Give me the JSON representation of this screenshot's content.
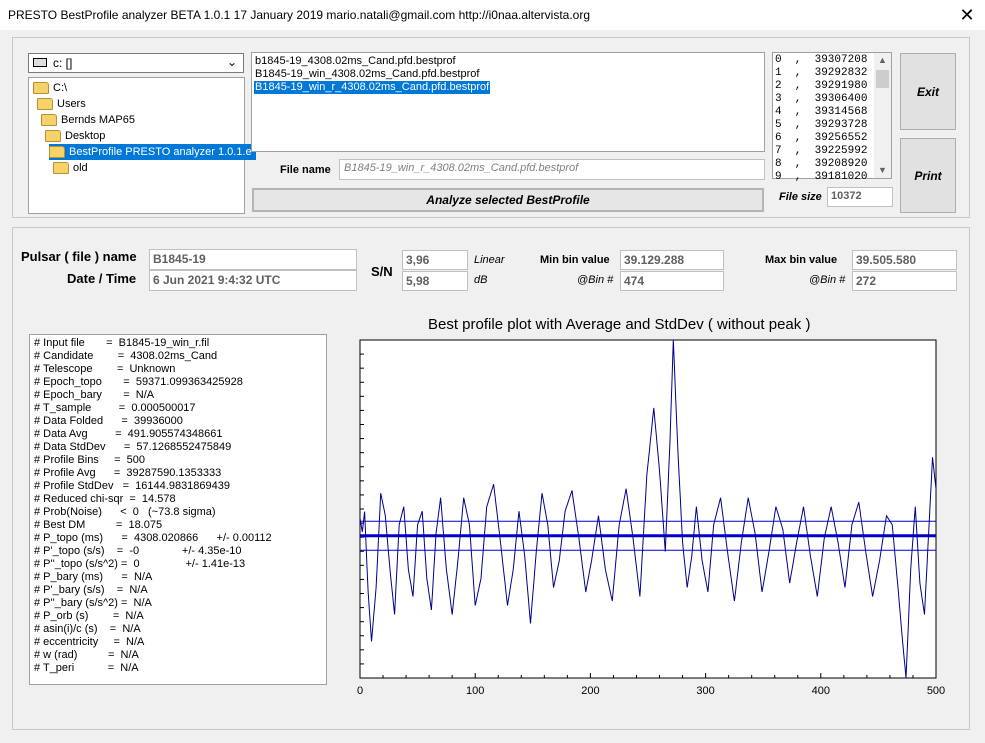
{
  "window": {
    "title": "PRESTO BestProfile analyzer BETA 1.0.1   17 January 2019      mario.natali@gmail.com      http://i0naa.altervista.org",
    "close_glyph": "✕"
  },
  "drive": {
    "label": "c: []",
    "chevron": "⌄"
  },
  "folders": [
    {
      "label": "C:\\",
      "indent": 0,
      "selected": false
    },
    {
      "label": "Users",
      "indent": 1,
      "selected": false
    },
    {
      "label": "Bernds MAP65",
      "indent": 2,
      "selected": false
    },
    {
      "label": "Desktop",
      "indent": 3,
      "selected": false
    },
    {
      "label": "BestProfile PRESTO analyzer 1.0.1.e",
      "indent": 4,
      "selected": true
    },
    {
      "label": "old",
      "indent": 5,
      "selected": false
    }
  ],
  "files": [
    {
      "label": "b1845-19_4308.02ms_Cand.pfd.bestprof",
      "selected": false
    },
    {
      "label": "B1845-19_win_4308.02ms_Cand.pfd.bestprof",
      "selected": false
    },
    {
      "label": "B1845-19_win_r_4308.02ms_Cand.pfd.bestprof",
      "selected": true
    }
  ],
  "bins": [
    "0  ,  39307208",
    "1  ,  39292832",
    "2  ,  39291980",
    "3  ,  39306400",
    "4  ,  39314568",
    "5  ,  39293728",
    "6  ,  39256552",
    "7  ,  39225992",
    "8  ,  39208920",
    "9  ,  39181020"
  ],
  "scroll": {
    "up": "▲",
    "down": "▼"
  },
  "buttons": {
    "exit": "Exit",
    "print": "Print",
    "analyze": "Analyze selected BestProfile"
  },
  "filename": {
    "label": "File name",
    "value": "B1845-19_win_r_4308.02ms_Cand.pfd.bestprof"
  },
  "filesize": {
    "label": "File size",
    "value": "10372"
  },
  "pulsar": {
    "name_label": "Pulsar ( file ) name",
    "name_value": "B1845-19",
    "datetime_label": "Date / Time",
    "datetime_value": "6 Jun 2021      9:4:32  UTC"
  },
  "sn": {
    "label": "S/N",
    "linear": "3,96",
    "linear_label": "Linear",
    "db": "5,98",
    "db_label": "dB"
  },
  "minbin": {
    "label": "Min bin value",
    "value": "39.129.288",
    "bin_label": "@Bin #",
    "bin": "474"
  },
  "maxbin": {
    "label": "Max bin value",
    "value": "39.505.580",
    "bin_label": "@Bin #",
    "bin": "272"
  },
  "info_lines": [
    "# Input file       =  B1845-19_win_r.fil",
    "# Candidate        =  4308.02ms_Cand",
    "# Telescope        =  Unknown",
    "# Epoch_topo       =  59371.099363425928",
    "# Epoch_bary       =  N/A",
    "# T_sample         =  0.000500017",
    "# Data Folded      =  39936000",
    "# Data Avg         =  491.905574348661",
    "# Data StdDev      =  57.1268552475849",
    "# Profile Bins     =  500",
    "# Profile Avg      =  39287590.1353333",
    "# Profile StdDev   =  16144.9831869439",
    "# Reduced chi-sqr  =  14.578",
    "# Prob(Noise)      <  0   (~73.8 sigma)",
    "# Best DM          =  18.075",
    "# P_topo (ms)      =  4308.020866      +/- 0.00112",
    "# P'_topo (s/s)    =  -0              +/- 4.35e-10",
    "# P''_topo (s/s^2) =  0               +/- 1.41e-13",
    "# P_bary (ms)      =  N/A",
    "# P'_bary (s/s)    =  N/A",
    "# P''_bary (s/s^2) =  N/A",
    "# P_orb (s)        =  N/A",
    "# asin(i)/c (s)    =  N/A",
    "# eccentricity     =  N/A",
    "# w (rad)          =  N/A",
    "# T_peri           =  N/A"
  ],
  "chart_data": {
    "type": "line",
    "title": "Best profile plot with  Average and StdDev ( without peak )",
    "xlim": [
      0,
      500
    ],
    "x_ticks": [
      0,
      100,
      200,
      300,
      400,
      500
    ],
    "ylim": [
      39129288,
      39505580
    ],
    "y_minor_ticks": 24,
    "hlines": {
      "avg": 39287590,
      "upper": 39303735,
      "lower": 39271445
    },
    "colors": {
      "line": "#00008b",
      "avg": "#0000cd",
      "std": "#0000cd"
    },
    "anchors": [
      [
        0,
        39307208
      ],
      [
        2,
        39291980
      ],
      [
        4,
        39314568
      ],
      [
        7,
        39225992
      ],
      [
        10,
        39170000
      ],
      [
        14,
        39230000
      ],
      [
        18,
        39335000
      ],
      [
        22,
        39310000
      ],
      [
        26,
        39250000
      ],
      [
        30,
        39200000
      ],
      [
        34,
        39300000
      ],
      [
        38,
        39320000
      ],
      [
        42,
        39250000
      ],
      [
        46,
        39220000
      ],
      [
        50,
        39300000
      ],
      [
        54,
        39315000
      ],
      [
        58,
        39240000
      ],
      [
        62,
        39205000
      ],
      [
        66,
        39290000
      ],
      [
        70,
        39330000
      ],
      [
        75,
        39250000
      ],
      [
        80,
        39200000
      ],
      [
        85,
        39260000
      ],
      [
        90,
        39330000
      ],
      [
        95,
        39300000
      ],
      [
        100,
        39210000
      ],
      [
        105,
        39240000
      ],
      [
        110,
        39320000
      ],
      [
        116,
        39345000
      ],
      [
        122,
        39280000
      ],
      [
        128,
        39210000
      ],
      [
        133,
        39250000
      ],
      [
        138,
        39315000
      ],
      [
        143,
        39265000
      ],
      [
        148,
        39190000
      ],
      [
        153,
        39270000
      ],
      [
        158,
        39335000
      ],
      [
        163,
        39300000
      ],
      [
        168,
        39230000
      ],
      [
        173,
        39260000
      ],
      [
        178,
        39315000
      ],
      [
        184,
        39338000
      ],
      [
        190,
        39285000
      ],
      [
        196,
        39225000
      ],
      [
        201,
        39260000
      ],
      [
        207,
        39310000
      ],
      [
        213,
        39250000
      ],
      [
        219,
        39215000
      ],
      [
        225,
        39300000
      ],
      [
        231,
        39340000
      ],
      [
        237,
        39285000
      ],
      [
        243,
        39220000
      ],
      [
        249,
        39355000
      ],
      [
        255,
        39430000
      ],
      [
        260,
        39360000
      ],
      [
        265,
        39270000
      ],
      [
        269,
        39390000
      ],
      [
        272,
        39505580
      ],
      [
        276,
        39380000
      ],
      [
        280,
        39280000
      ],
      [
        284,
        39230000
      ],
      [
        288,
        39265000
      ],
      [
        292,
        39320000
      ],
      [
        297,
        39260000
      ],
      [
        302,
        39225000
      ],
      [
        307,
        39300000
      ],
      [
        313,
        39330000
      ],
      [
        319,
        39270000
      ],
      [
        325,
        39215000
      ],
      [
        331,
        39280000
      ],
      [
        337,
        39330000
      ],
      [
        343,
        39290000
      ],
      [
        349,
        39225000
      ],
      [
        355,
        39270000
      ],
      [
        361,
        39320000
      ],
      [
        367,
        39295000
      ],
      [
        373,
        39235000
      ],
      [
        379,
        39280000
      ],
      [
        385,
        39320000
      ],
      [
        391,
        39265000
      ],
      [
        397,
        39220000
      ],
      [
        403,
        39285000
      ],
      [
        409,
        39320000
      ],
      [
        415,
        39280000
      ],
      [
        421,
        39230000
      ],
      [
        427,
        39300000
      ],
      [
        433,
        39325000
      ],
      [
        439,
        39270000
      ],
      [
        445,
        39220000
      ],
      [
        451,
        39260000
      ],
      [
        457,
        39310000
      ],
      [
        462,
        39300000
      ],
      [
        467,
        39230000
      ],
      [
        471,
        39170000
      ],
      [
        474,
        39129288
      ],
      [
        478,
        39250000
      ],
      [
        482,
        39320000
      ],
      [
        486,
        39235000
      ],
      [
        490,
        39200000
      ],
      [
        494,
        39300000
      ],
      [
        497,
        39375000
      ],
      [
        500,
        39340000
      ]
    ]
  }
}
